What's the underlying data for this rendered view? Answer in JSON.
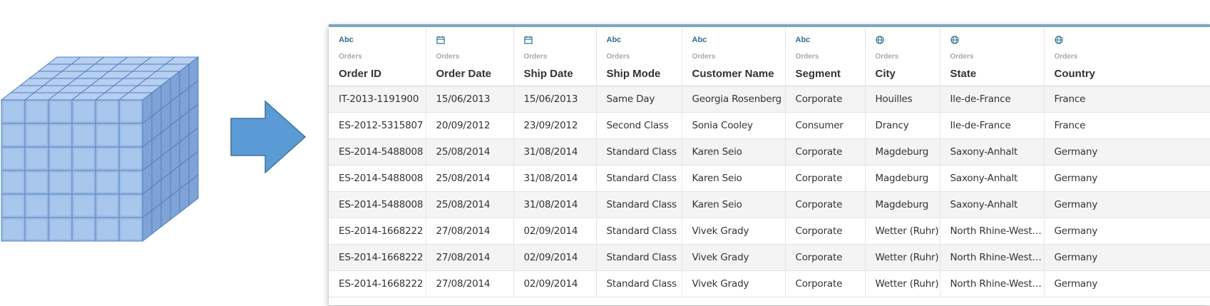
{
  "columns": [
    {
      "type": "Abc",
      "icon": "string-type-icon",
      "source": "Orders",
      "name": "Order ID"
    },
    {
      "type": "date",
      "icon": "calendar-icon",
      "source": "Orders",
      "name": "Order Date"
    },
    {
      "type": "date",
      "icon": "calendar-icon",
      "source": "Orders",
      "name": "Ship Date"
    },
    {
      "type": "Abc",
      "icon": "string-type-icon",
      "source": "Orders",
      "name": "Ship Mode"
    },
    {
      "type": "Abc",
      "icon": "string-type-icon",
      "source": "Orders",
      "name": "Customer Name"
    },
    {
      "type": "Abc",
      "icon": "string-type-icon",
      "source": "Orders",
      "name": "Segment"
    },
    {
      "type": "geo",
      "icon": "globe-icon",
      "source": "Orders",
      "name": "City"
    },
    {
      "type": "geo",
      "icon": "globe-icon",
      "source": "Orders",
      "name": "State"
    },
    {
      "type": "geo",
      "icon": "globe-icon",
      "source": "Orders",
      "name": "Country"
    }
  ],
  "rows": [
    [
      "IT-2013-1191900",
      "15/06/2013",
      "15/06/2013",
      "Same Day",
      "Georgia Rosenberg",
      "Corporate",
      "Houilles",
      "Ile-de-France",
      "France"
    ],
    [
      "ES-2012-5315807",
      "20/09/2012",
      "23/09/2012",
      "Second Class",
      "Sonia Cooley",
      "Consumer",
      "Drancy",
      "Ile-de-France",
      "France"
    ],
    [
      "ES-2014-5488008",
      "25/08/2014",
      "31/08/2014",
      "Standard Class",
      "Karen Seio",
      "Corporate",
      "Magdeburg",
      "Saxony-Anhalt",
      "Germany"
    ],
    [
      "ES-2014-5488008",
      "25/08/2014",
      "31/08/2014",
      "Standard Class",
      "Karen Seio",
      "Corporate",
      "Magdeburg",
      "Saxony-Anhalt",
      "Germany"
    ],
    [
      "ES-2014-5488008",
      "25/08/2014",
      "31/08/2014",
      "Standard Class",
      "Karen Seio",
      "Corporate",
      "Magdeburg",
      "Saxony-Anhalt",
      "Germany"
    ],
    [
      "ES-2014-1668222",
      "27/08/2014",
      "02/09/2014",
      "Standard Class",
      "Vivek Grady",
      "Corporate",
      "Wetter (Ruhr)",
      "North Rhine-Westpha...",
      "Germany"
    ],
    [
      "ES-2014-1668222",
      "27/08/2014",
      "02/09/2014",
      "Standard Class",
      "Vivek Grady",
      "Corporate",
      "Wetter (Ruhr)",
      "North Rhine-Westpha...",
      "Germany"
    ],
    [
      "ES-2014-1668222",
      "27/08/2014",
      "02/09/2014",
      "Standard Class",
      "Vivek Grady",
      "Corporate",
      "Wetter (Ruhr)",
      "North Rhine-Westpha...",
      "Germany"
    ]
  ],
  "colors": {
    "cube_face": "#9dbce4",
    "cube_edge": "#4f7fbf",
    "arrow": "#5b9bd5",
    "arrow_edge": "#41719c",
    "header_accent": "#7fa6bd",
    "type_icon": "#2e6f8e"
  },
  "diagram": {
    "cube_icon": "data-cube-icon",
    "arrow_icon": "right-arrow-icon"
  }
}
